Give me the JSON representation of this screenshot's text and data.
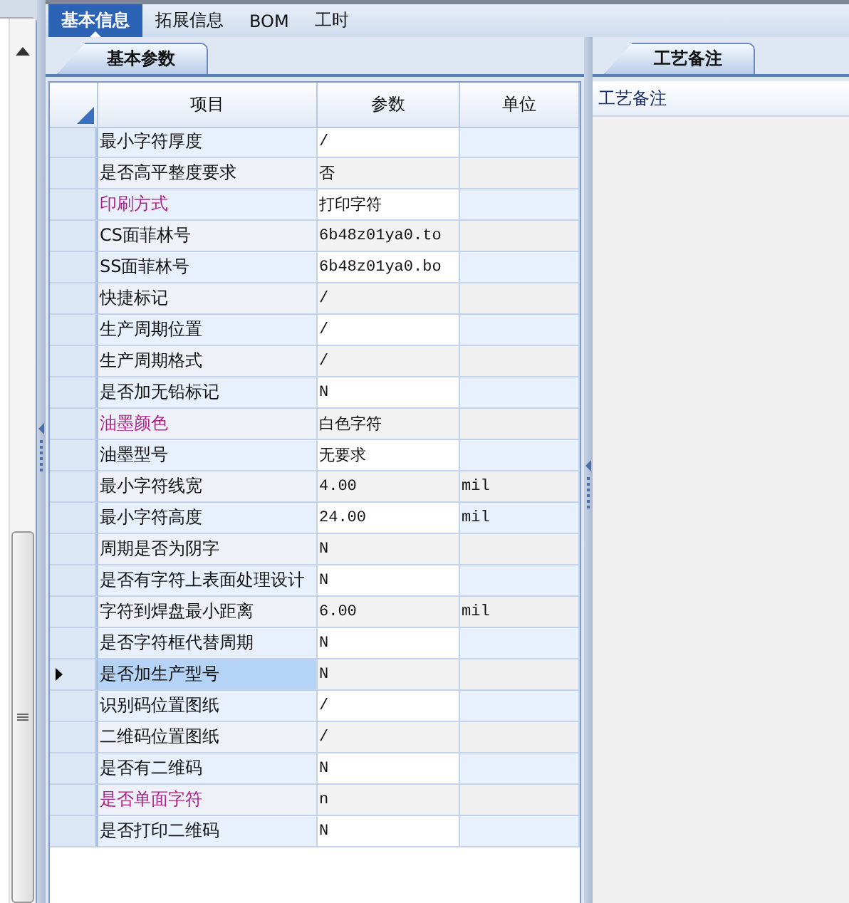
{
  "top_tabs": [
    {
      "label": "基本信息",
      "selected": true
    },
    {
      "label": "拓展信息",
      "selected": false
    },
    {
      "label": "BOM",
      "selected": false
    },
    {
      "label": "工时",
      "selected": false
    }
  ],
  "params_panel": {
    "tab": "基本参数",
    "columns": [
      "项目",
      "参数",
      "单位"
    ],
    "rows": [
      {
        "item": "最小字符厚度",
        "value": "/",
        "emphasized": false,
        "selected": false
      },
      {
        "item": "是否高平整度要求",
        "value": "否",
        "emphasized": false,
        "selected": false
      },
      {
        "item": "印刷方式",
        "value": "打印字符",
        "emphasized": true,
        "selected": false
      },
      {
        "item": "CS面菲林号",
        "value": "6b48z01ya0.to",
        "emphasized": false,
        "selected": false
      },
      {
        "item": "SS面菲林号",
        "value": "6b48z01ya0.bo",
        "emphasized": false,
        "selected": false
      },
      {
        "item": "快捷标记",
        "value": "/",
        "emphasized": false,
        "selected": false
      },
      {
        "item": "生产周期位置",
        "value": "/",
        "emphasized": false,
        "selected": false
      },
      {
        "item": "生产周期格式",
        "value": "/",
        "emphasized": false,
        "selected": false
      },
      {
        "item": "是否加无铅标记",
        "value": "N",
        "emphasized": false,
        "selected": false
      },
      {
        "item": "油墨颜色",
        "value": "白色字符",
        "emphasized": true,
        "selected": false
      },
      {
        "item": "油墨型号",
        "value": "无要求",
        "emphasized": false,
        "selected": false
      },
      {
        "item": "最小字符线宽",
        "value": "4.00",
        "unit": "mil",
        "emphasized": false,
        "selected": false
      },
      {
        "item": "最小字符高度",
        "value": "24.00",
        "unit": "mil",
        "emphasized": false,
        "selected": false
      },
      {
        "item": "周期是否为阴字",
        "value": "N",
        "emphasized": false,
        "selected": false
      },
      {
        "item": "是否有字符上表面处理设计",
        "value": "N",
        "emphasized": false,
        "selected": false
      },
      {
        "item": "字符到焊盘最小距离",
        "value": "6.00",
        "unit": "mil",
        "emphasized": false,
        "selected": false
      },
      {
        "item": "是否字符框代替周期",
        "value": "N",
        "emphasized": false,
        "selected": false
      },
      {
        "item": "是否加生产型号",
        "value": "N",
        "emphasized": false,
        "selected": true
      },
      {
        "item": "识别码位置图纸",
        "value": "/",
        "emphasized": false,
        "selected": false
      },
      {
        "item": "二维码位置图纸",
        "value": "/",
        "emphasized": false,
        "selected": false
      },
      {
        "item": "是否有二维码",
        "value": "N",
        "emphasized": false,
        "selected": false
      },
      {
        "item": "是否单面字符",
        "value": "n",
        "emphasized": true,
        "selected": false
      },
      {
        "item": "是否打印二维码",
        "value": "N",
        "emphasized": false,
        "selected": false
      }
    ]
  },
  "notes_panel": {
    "tab": "工艺备注",
    "field_label": "工艺备注"
  }
}
